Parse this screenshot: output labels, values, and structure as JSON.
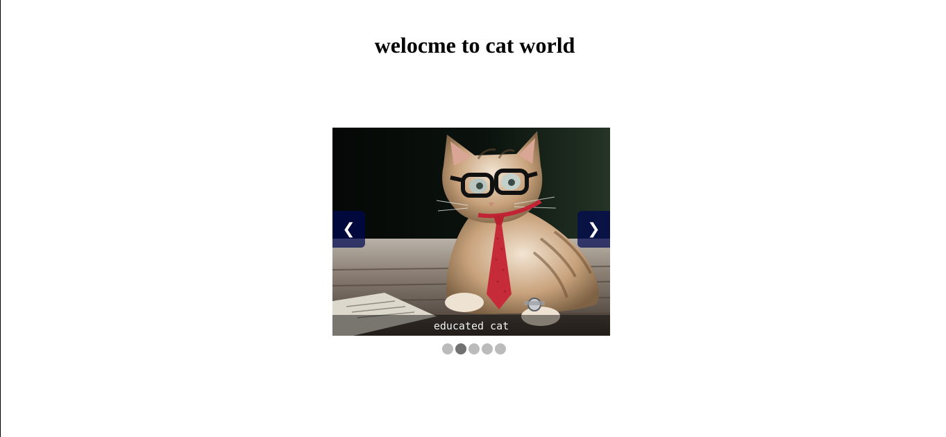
{
  "page": {
    "title": "welocme to cat world"
  },
  "slideshow": {
    "prev_label": "❮",
    "next_label": "❯",
    "caption": "educated cat",
    "image_subject": "kitten wearing glasses and red tie",
    "active_slide": 2,
    "slides": [
      {
        "label": "slide 1"
      },
      {
        "label": "slide 2"
      },
      {
        "label": "slide 3"
      },
      {
        "label": "slide 4"
      },
      {
        "label": "slide 5"
      }
    ],
    "colors": {
      "nav_background": "#000850",
      "dot_inactive": "#bbbbbb",
      "dot_active": "#717171"
    }
  }
}
